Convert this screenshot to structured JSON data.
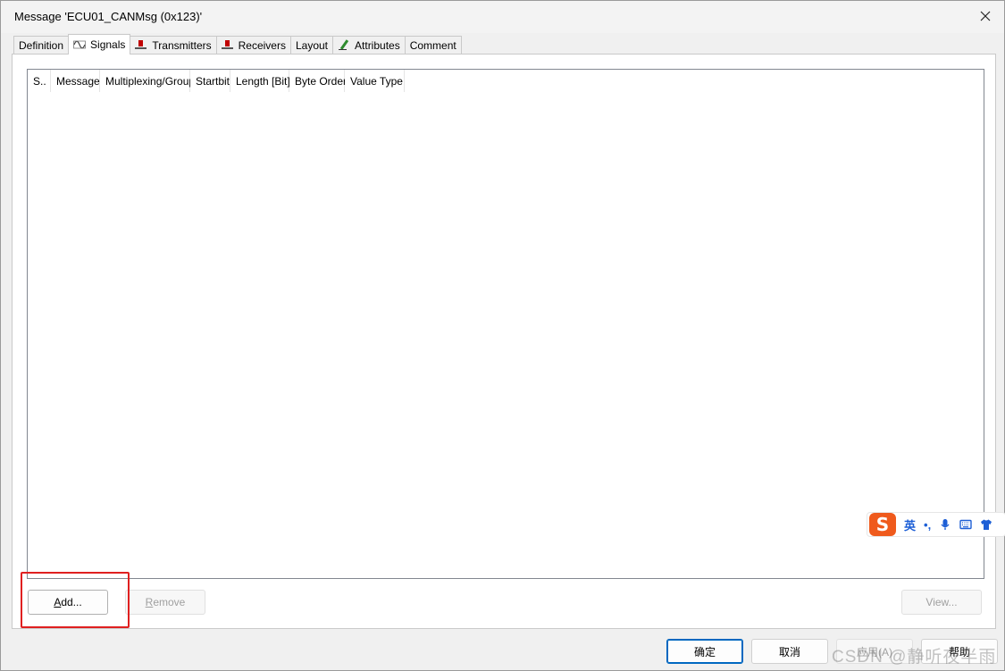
{
  "window": {
    "title": "Message 'ECU01_CANMsg (0x123)'"
  },
  "tabs": [
    {
      "label": "Definition",
      "icon": ""
    },
    {
      "label": "Signals",
      "icon": "signal-wave-icon",
      "active": true
    },
    {
      "label": "Transmitters",
      "icon": "transmitter-icon"
    },
    {
      "label": "Receivers",
      "icon": "receiver-icon"
    },
    {
      "label": "Layout",
      "icon": ""
    },
    {
      "label": "Attributes",
      "icon": "attributes-pen-icon"
    },
    {
      "label": "Comment",
      "icon": ""
    }
  ],
  "signals_table": {
    "columns": [
      "S..",
      "Message",
      "Multiplexing/Group",
      "Startbit",
      "Length [Bit]",
      "Byte Order",
      "Value Type"
    ],
    "rows": []
  },
  "buttons": {
    "add": "Add...",
    "remove": "Remove",
    "view": "View...",
    "ok": "确定",
    "cancel": "取消",
    "apply": "应用(A)",
    "help": "帮助"
  },
  "ime_toolbar": {
    "logo": "S",
    "mode": "英",
    "punct": "•,",
    "icons": [
      "microphone-icon",
      "keyboard-icon",
      "skin-shirt-icon"
    ]
  },
  "watermark": "CSDN @静听夜半雨",
  "colors": {
    "accent": "#0067c0",
    "highlight": "#e02020",
    "ime_logo": "#ef5a1c",
    "ime_icon": "#1d5fd6"
  }
}
